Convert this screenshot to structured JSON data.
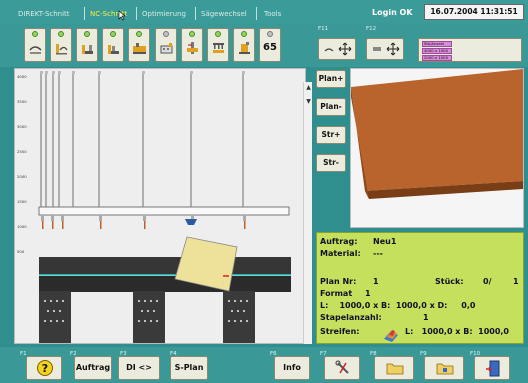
{
  "tabs": [
    {
      "label": "DIREKT-Schnitt",
      "active": false
    },
    {
      "label": "NC-Schnitt",
      "active": true
    },
    {
      "label": "Optimierung",
      "active": false
    },
    {
      "label": "Sägewechsel",
      "active": false
    },
    {
      "label": "Tools",
      "active": false
    }
  ],
  "header": {
    "login_status": "Login OK",
    "datetime": "16.07.2004  11:31:51"
  },
  "toolbar": {
    "counter_value": "65",
    "f11_label": "F11",
    "f12_label": "F12",
    "legend": [
      "Stk/Anzahl",
      "4000 x 1000",
      "2000 x 1000"
    ]
  },
  "drawing": {
    "y_axis_labels": [
      "4000",
      "3500",
      "3000",
      "2500",
      "2000",
      "1500",
      "1000",
      "500"
    ]
  },
  "side_buttons": {
    "plan_plus": "Plan+",
    "plan_minus": "Plan-",
    "str_plus": "Str+",
    "str_minus": "Str-"
  },
  "info": {
    "auftrag_label": "Auftrag:",
    "auftrag_value": "Neu1",
    "material_label": "Material:",
    "material_value": "---",
    "plan_nr_label": "Plan Nr:",
    "plan_nr_value": "1",
    "stueck_label": "Stück:",
    "stueck_value": "0/",
    "stueck_total": "1",
    "format_label": "Format",
    "format_value": "1",
    "dims_line": "L:    1000,0 x B:  1000,0 x D:     0,0",
    "stapelanzahl_label": "Stapelanzahl:",
    "stapelanzahl_value": "1",
    "streifen_label": "Streifen:",
    "streifen_dims": "L:   1000,0 x B:  1000,0"
  },
  "bottom": {
    "f1": "F1",
    "f2": "F2",
    "f3": "F3",
    "f4": "F4",
    "f6": "F6",
    "f7": "F7",
    "f8": "F8",
    "f9": "F9",
    "f10": "F10",
    "auftrag": "Auftrag",
    "di_nc": "DI <> NC",
    "s_plan": "S-Plan",
    "info": "Info"
  },
  "colors": {
    "accent_tab": "#ffee44",
    "info_panel": "#c4e05c",
    "board": "#b8642c"
  }
}
